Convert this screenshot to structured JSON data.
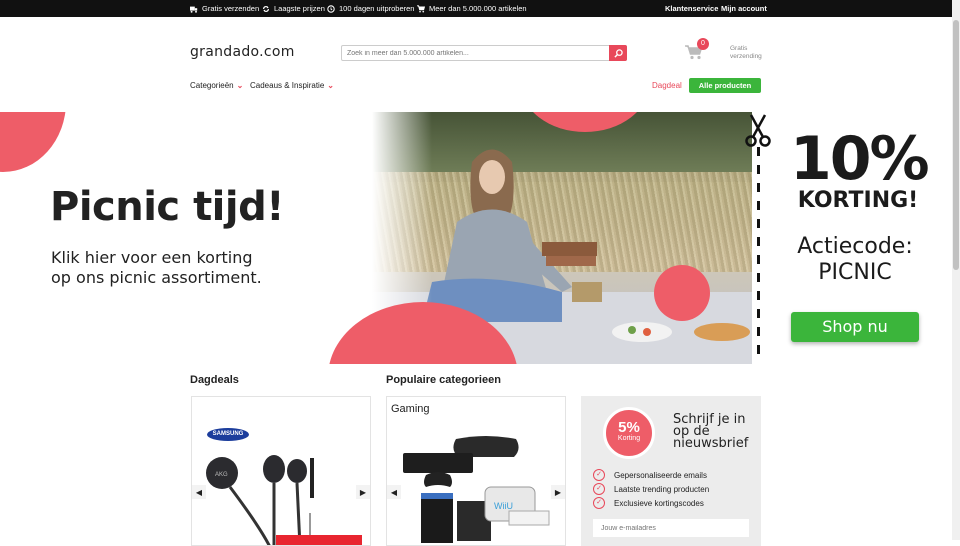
{
  "topbar": {
    "usps": [
      {
        "icon": "truck-icon",
        "label": "Gratis verzenden"
      },
      {
        "icon": "refresh-icon",
        "label": "Laagste prijzen"
      },
      {
        "icon": "clock-icon",
        "label": "100 dagen uitproberen"
      },
      {
        "icon": "cart-icon",
        "label": "Meer dan 5.000.000 artikelen"
      }
    ],
    "customer_service": "Klantenservice",
    "account": "Mijn account"
  },
  "header": {
    "logo": "grandado.com",
    "search_placeholder": "Zoek in meer dan 5.000.000 artikelen...",
    "cart_count": "0",
    "shipping_line1": "Gratis",
    "shipping_line2": "verzending"
  },
  "nav": {
    "categories": "Categorieën",
    "gifts": "Cadeaus & Inspiratie",
    "dagdeal": "Dagdeal",
    "all_products": "Alle producten"
  },
  "banner": {
    "headline": "Picnic tijd!",
    "sub_line1": "Klik hier voor een korting",
    "sub_line2": "op ons picnic assortiment.",
    "percent": "10%",
    "korting": "KORTING!",
    "action_line1": "Actiecode:",
    "action_line2": "PICNIC",
    "shop_button": "Shop nu"
  },
  "sections": {
    "dagdeals_title": "Dagdeals",
    "popular_title": "Populaire categorieen",
    "gaming_caption": "Gaming",
    "brand_logo": "SAMSUNG"
  },
  "newsletter": {
    "badge_big": "5%",
    "badge_small": "Korting",
    "title": "Schrijf je in op de nieuwsbrief",
    "perks": [
      "Gepersonaliseerde emails",
      "Laatste trending producten",
      "Exclusieve kortingscodes"
    ],
    "email_placeholder": "Jouw e-mailadres"
  },
  "colors": {
    "accent": "#e8485a",
    "green": "#3bb53b",
    "topbar": "#111111"
  }
}
